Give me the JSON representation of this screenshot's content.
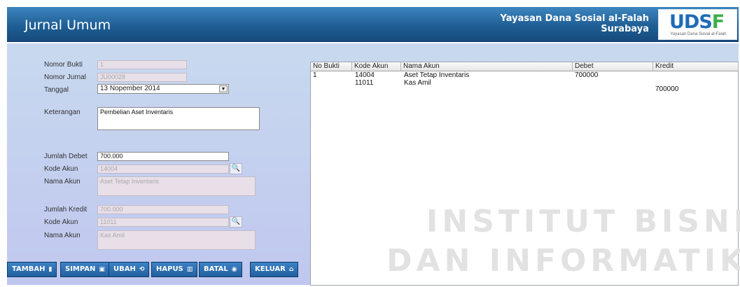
{
  "header": {
    "title": "Jurnal Umum",
    "org_line1": "Yayasan Dana Sosial al-Falah",
    "org_line2": "Surabaya",
    "logo_text": "YDSF",
    "logo_sub": "Yayasan Dana Sosial al-Falah"
  },
  "form": {
    "nomor_bukti_label": "Nomor Bukti",
    "nomor_bukti_value": "1",
    "nomor_jurnal_label": "Nomor Jurnal",
    "nomor_jurnal_value": "JU00028",
    "tanggal_label": "Tanggal",
    "tanggal_value": "13 Nopember 2014",
    "keterangan_label": "Keterangan",
    "keterangan_value": "Pembelian Aset Inventaris",
    "jumlah_debet_label": "Jumlah Debet",
    "jumlah_debet_value": "700.000",
    "kode_akun_debet_label": "Kode Akun",
    "kode_akun_debet_value": "14004",
    "nama_akun_debet_label": "Nama Akun",
    "nama_akun_debet_value": "Aset Tetap Inventaris",
    "jumlah_kredit_label": "Jumlah Kredit",
    "jumlah_kredit_value": "700.000",
    "kode_akun_kredit_label": "Kode Akun",
    "kode_akun_kredit_value": "11011",
    "nama_akun_kredit_label": "Nama Akun",
    "nama_akun_kredit_value": "Kas Amil"
  },
  "buttons": {
    "tambah": "TAMBAH",
    "simpan": "SIMPAN",
    "ubah": "UBAH",
    "hapus": "HAPUS",
    "batal": "BATAL",
    "keluar": "KELUAR"
  },
  "table": {
    "columns": [
      "No Bukti",
      "Kode Akun",
      "Nama Akun",
      "Debet",
      "Kredit"
    ],
    "rows": [
      {
        "no_bukti": "1",
        "kode_akun": "14004",
        "nama_akun": "Aset Tetap Inventaris",
        "debet": "700000",
        "kredit": ""
      },
      {
        "no_bukti": "",
        "kode_akun": "11011",
        "nama_akun": "Kas Amil",
        "debet": "",
        "kredit": "700000"
      }
    ]
  },
  "watermark": {
    "line1": "INSTITUT BISNIS",
    "line2": "DAN INFORMATIKA"
  },
  "colors": {
    "header_blue": "#1f5e95",
    "button_blue": "#2a6db0",
    "panel_lavender": "#c0c7ef"
  }
}
